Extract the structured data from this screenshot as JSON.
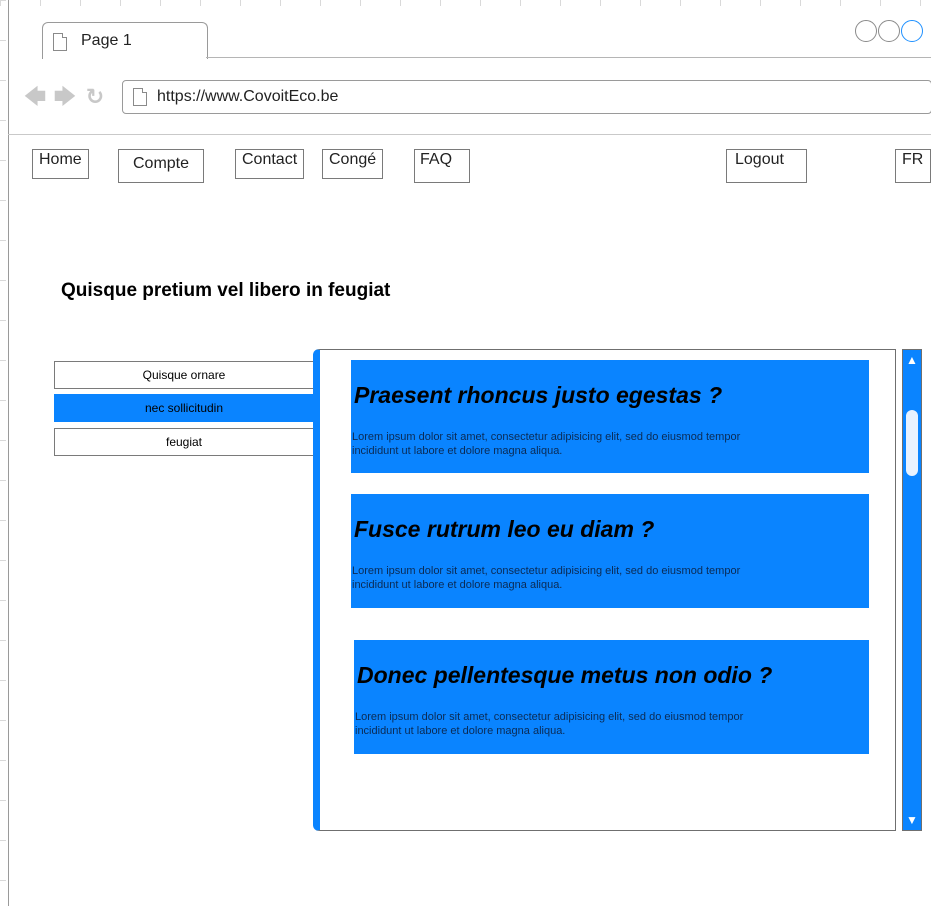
{
  "browser": {
    "tab_label": "Page 1",
    "url": "https://www.CovoitEco.be"
  },
  "menu": {
    "home": "Home",
    "compte": "Compte",
    "contact": "Contact",
    "conge": "Congé",
    "faq": "FAQ",
    "logout": "Logout",
    "lang": "FR"
  },
  "page": {
    "title": "Quisque pretium vel libero in feugiat"
  },
  "sidebar": {
    "items": [
      {
        "label": "Quisque ornare",
        "active": false
      },
      {
        "label": "nec sollicitudin",
        "active": true
      },
      {
        "label": "feugiat",
        "active": false
      }
    ]
  },
  "faq": [
    {
      "question": "Praesent rhoncus justo egestas ?",
      "answer_line1": "Lorem ipsum dolor sit amet, consectetur adipisicing elit, sed do eiusmod tempor",
      "answer_line2": "incididunt ut labore et dolore magna aliqua."
    },
    {
      "question": "Fusce rutrum leo eu diam ?",
      "answer_line1": "Lorem ipsum dolor sit amet, consectetur adipisicing elit, sed do eiusmod tempor",
      "answer_line2": "incididunt ut labore et dolore magna aliqua."
    },
    {
      "question": "Donec pellentesque metus non odio ?",
      "answer_line1": "Lorem ipsum dolor sit amet, consectetur adipisicing elit, sed do eiusmod tempor",
      "answer_line2": "incididunt ut labore et dolore magna aliqua."
    }
  ],
  "icons": {
    "back": "arrow-left-icon",
    "forward": "arrow-right-icon",
    "reload": "reload-icon",
    "page": "document-icon"
  },
  "colors": {
    "accent": "#0a84ff"
  }
}
